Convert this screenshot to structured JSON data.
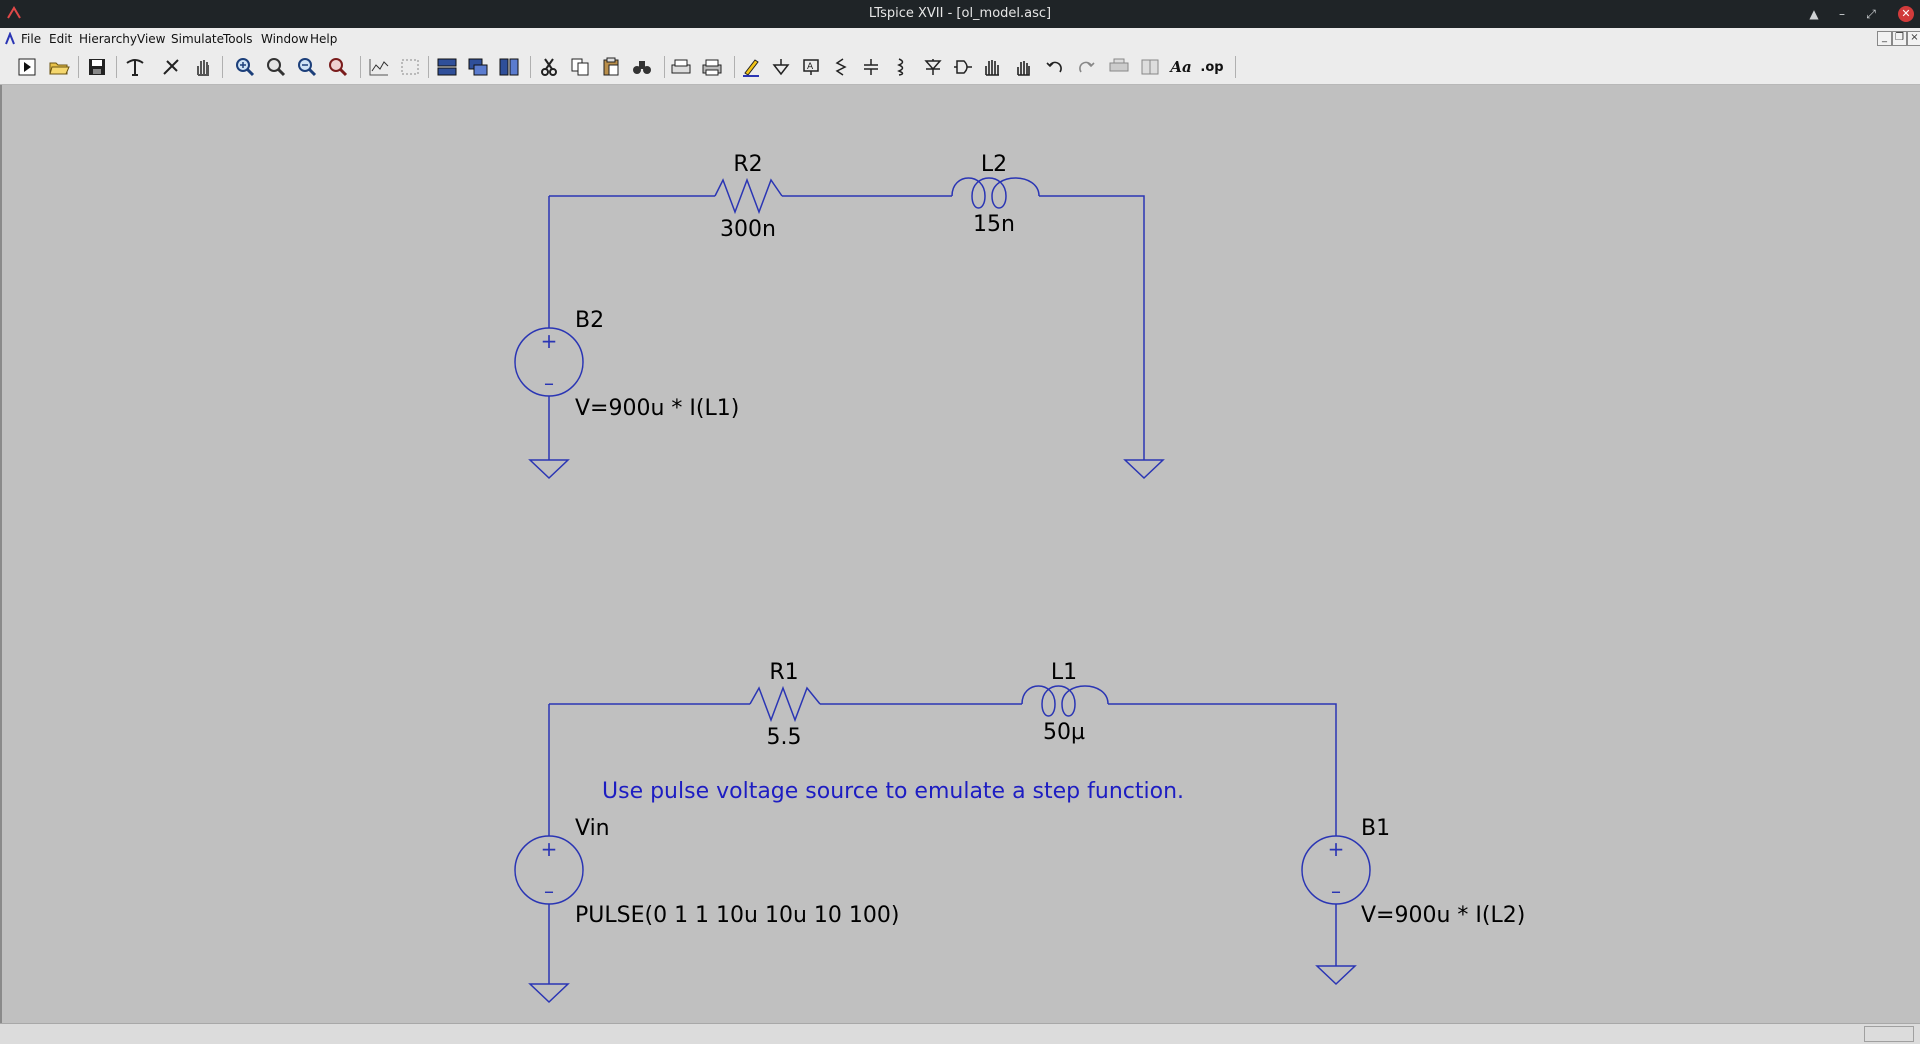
{
  "window": {
    "title": "LTspice XVII - [ol_model.asc]"
  },
  "menu": [
    {
      "label": "File"
    },
    {
      "label": "Edit"
    },
    {
      "label": "Hierarchy"
    },
    {
      "label": "View"
    },
    {
      "label": "Simulate"
    },
    {
      "label": "Tools"
    },
    {
      "label": "Window"
    },
    {
      "label": "Help"
    }
  ],
  "toolbar": {
    "items": [
      "run-icon",
      "open-folder-icon",
      "save-icon",
      "control-panel-icon",
      "halt-icon",
      "pan-hand-icon",
      "zoom-in-icon",
      "zoom-area-icon",
      "zoom-out-icon",
      "zoom-fit-icon",
      "autorange-icon",
      "delete-plot-icon",
      "tile-horizontal-icon",
      "cascade-icon",
      "tile-vertical-icon",
      "cut-icon",
      "copy-icon",
      "paste-icon",
      "find-icon",
      "print-preview-icon",
      "print-icon",
      "draw-wire-icon",
      "ground-icon",
      "label-net-icon",
      "resistor-icon",
      "capacitor-icon",
      "inductor-icon",
      "diode-icon",
      "component-icon",
      "move-hand-icon",
      "drag-hand-icon",
      "undo-icon",
      "redo-icon",
      "rotate-icon",
      "mirror-icon",
      "text-icon",
      "spice-directive-icon"
    ],
    "text_aa": "Aa",
    "text_op": ".op"
  },
  "schematic": {
    "r2": {
      "name": "R2",
      "value": "300n"
    },
    "l2": {
      "name": "L2",
      "value": "15n"
    },
    "b2": {
      "name": "B2",
      "value": "V=900u * I(L1)"
    },
    "r1": {
      "name": "R1",
      "value": "5.5"
    },
    "l1": {
      "name": "L1",
      "value": "50µ"
    },
    "vin": {
      "name": "Vin",
      "value": "PULSE(0 1 1 10u 10u 10 100)"
    },
    "b1": {
      "name": "B1",
      "value": "V=900u * I(L2)"
    },
    "comment": "Use pulse voltage source to emulate a step function.",
    "source_plus": "+",
    "source_minus": "–"
  },
  "colors": {
    "wire": "#2a35b4",
    "comment": "#1d1dc2",
    "canvas": "#c0c0c0",
    "text": "#000000"
  }
}
